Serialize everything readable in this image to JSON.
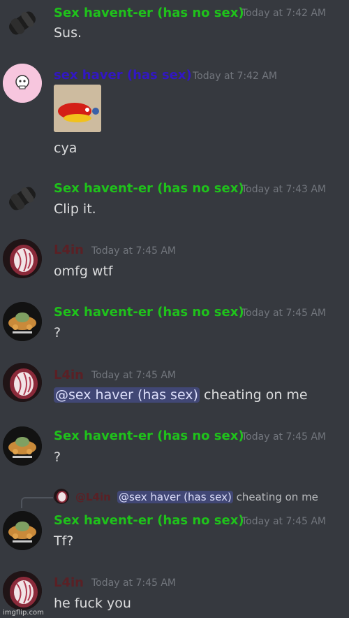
{
  "colors": {
    "background": "#36393f",
    "green_name": "#1fc21b",
    "purple_name": "#3217c4",
    "dark_red_name": "#5a2025",
    "timestamp": "#72767d",
    "text": "#dcddde",
    "mention_bg": "#414775"
  },
  "messages": [
    {
      "author": "Sex havent-er (has no sex)",
      "time": "Today at 7:42 AM",
      "text": "Sus."
    },
    {
      "author": "sex haver (has sex)",
      "time": "Today at 7:42 AM",
      "text": "cya"
    },
    {
      "author": "Sex havent-er (has no sex)",
      "time": "Today at 7:43 AM",
      "text": "Clip it."
    },
    {
      "author": "L4in",
      "time": "Today at 7:45 AM",
      "text": "omfg wtf"
    },
    {
      "author": "Sex havent-er (has no sex)",
      "time": "Today at 7:45 AM",
      "text": "?"
    },
    {
      "author": "L4in",
      "time": "Today at 7:45 AM",
      "mention": "@sex haver (has sex)",
      "text": "cheating on me"
    },
    {
      "author": "Sex havent-er (has no sex)",
      "time": "Today at 7:45 AM",
      "text": "?"
    },
    {
      "author": "Sex havent-er (has no sex)",
      "time": "Today at 7:45 AM",
      "text": "Tf?",
      "reply": {
        "author": "@L4in",
        "mention": "@sex haver (has sex)",
        "text": "cheating on me"
      }
    },
    {
      "author": "L4in",
      "time": "Today at 7:45 AM",
      "text": "he fuck you"
    }
  ],
  "watermark": "imgflip.com"
}
